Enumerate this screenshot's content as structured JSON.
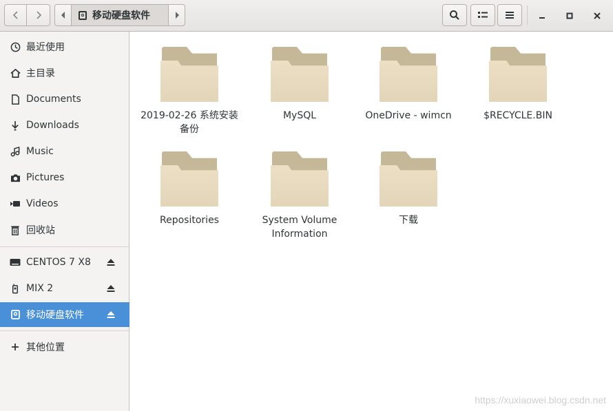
{
  "header": {
    "back_icon": "chevron-left",
    "forward_icon": "chevron-right",
    "path_label": "移动硬盘软件",
    "search_icon": "search",
    "view_icon": "list-view",
    "menu_icon": "hamburger-menu",
    "minimize_icon": "minimize",
    "maximize_icon": "maximize",
    "close_icon": "close"
  },
  "sidebar": {
    "places": [
      {
        "label": "最近使用",
        "icon": "clock"
      },
      {
        "label": "主目录",
        "icon": "home"
      },
      {
        "label": "Documents",
        "icon": "document"
      },
      {
        "label": "Downloads",
        "icon": "download"
      },
      {
        "label": "Music",
        "icon": "music"
      },
      {
        "label": "Pictures",
        "icon": "camera"
      },
      {
        "label": "Videos",
        "icon": "video"
      },
      {
        "label": "回收站",
        "icon": "trash"
      }
    ],
    "devices": [
      {
        "label": "CENTOS 7 X8",
        "icon": "drive",
        "eject": true
      },
      {
        "label": "MIX 2",
        "icon": "phone",
        "eject": true
      },
      {
        "label": "移动硬盘软件",
        "icon": "removable-drive",
        "eject": true,
        "active": true
      }
    ],
    "other": {
      "label": "其他位置",
      "icon": "plus"
    }
  },
  "files": [
    {
      "name": "2019-02-26  系统安装 备份"
    },
    {
      "name": "MySQL"
    },
    {
      "name": "OneDrive - wimcn"
    },
    {
      "name": "$RECYCLE.BIN"
    },
    {
      "name": "Repositories"
    },
    {
      "name": "System Volume Information"
    },
    {
      "name": "下载"
    }
  ],
  "watermark": "https://xuxiaowei.blog.csdn.net",
  "colors": {
    "accent": "#4a90d9",
    "folder": "#e6d9bc"
  }
}
